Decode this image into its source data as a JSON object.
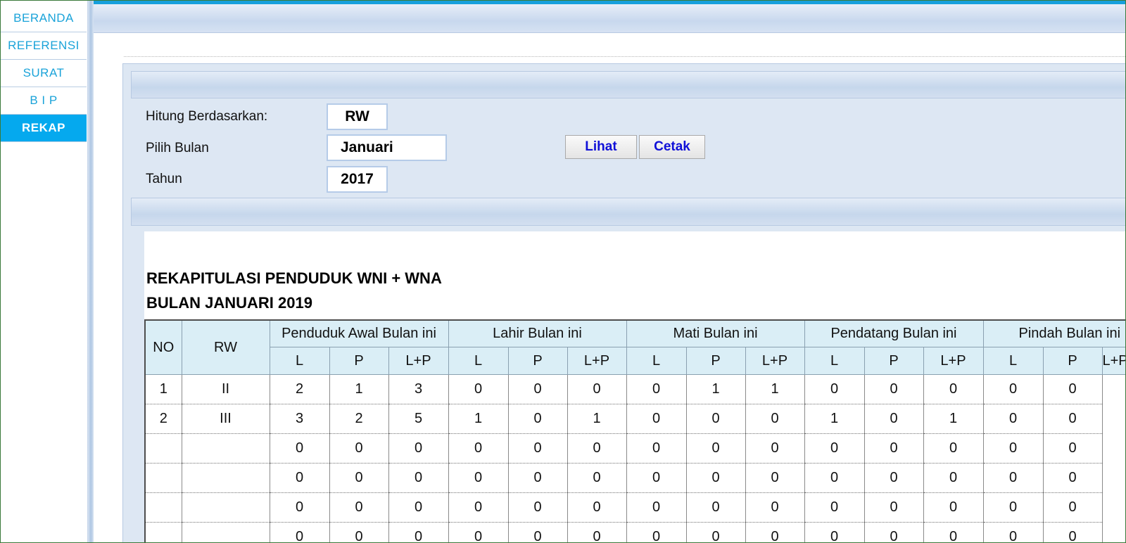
{
  "sidebar": {
    "items": [
      {
        "label": "BERANDA",
        "active": false
      },
      {
        "label": "REFERENSI",
        "active": false
      },
      {
        "label": "SURAT",
        "active": false
      },
      {
        "label": "B I P",
        "active": false
      },
      {
        "label": "REKAP",
        "active": true
      }
    ]
  },
  "form": {
    "basis_label": "Hitung Berdasarkan:",
    "basis_value": "RW",
    "month_label": "Pilih Bulan",
    "month_value": "Januari",
    "year_label": "Tahun",
    "year_value": "2017",
    "view_button": "Lihat",
    "print_button": "Cetak"
  },
  "report": {
    "title_line1": "REKAPITULASI PENDUDUK WNI + WNA",
    "title_line2": "BULAN JANUARI 2019",
    "columns": {
      "no": "NO",
      "rw": "RW",
      "groups": [
        "Penduduk Awal Bulan ini",
        "Lahir Bulan ini",
        "Mati Bulan ini",
        "Pendatang Bulan ini",
        "Pindah Bulan ini"
      ],
      "sub": [
        "L",
        "P",
        "L+P"
      ]
    },
    "rows": [
      {
        "no": "1",
        "rw": "II",
        "values": [
          "2",
          "1",
          "3",
          "0",
          "0",
          "0",
          "0",
          "1",
          "1",
          "0",
          "0",
          "0",
          "0",
          "0"
        ]
      },
      {
        "no": "2",
        "rw": "III",
        "values": [
          "3",
          "2",
          "5",
          "1",
          "0",
          "1",
          "0",
          "0",
          "0",
          "1",
          "0",
          "1",
          "0",
          "0"
        ]
      },
      {
        "no": "",
        "rw": "",
        "values": [
          "0",
          "0",
          "0",
          "0",
          "0",
          "0",
          "0",
          "0",
          "0",
          "0",
          "0",
          "0",
          "0",
          "0"
        ]
      },
      {
        "no": "",
        "rw": "",
        "values": [
          "0",
          "0",
          "0",
          "0",
          "0",
          "0",
          "0",
          "0",
          "0",
          "0",
          "0",
          "0",
          "0",
          "0"
        ]
      },
      {
        "no": "",
        "rw": "",
        "values": [
          "0",
          "0",
          "0",
          "0",
          "0",
          "0",
          "0",
          "0",
          "0",
          "0",
          "0",
          "0",
          "0",
          "0"
        ]
      },
      {
        "no": "",
        "rw": "",
        "values": [
          "0",
          "0",
          "0",
          "0",
          "0",
          "0",
          "0",
          "0",
          "0",
          "0",
          "0",
          "0",
          "0",
          "0"
        ]
      }
    ]
  },
  "colors": {
    "accent": "#05a9ee",
    "nav_text": "#1aa3d9",
    "header_fill": "#daeef6",
    "button_text": "#1010d8",
    "panel_bg": "#dde7f3"
  }
}
